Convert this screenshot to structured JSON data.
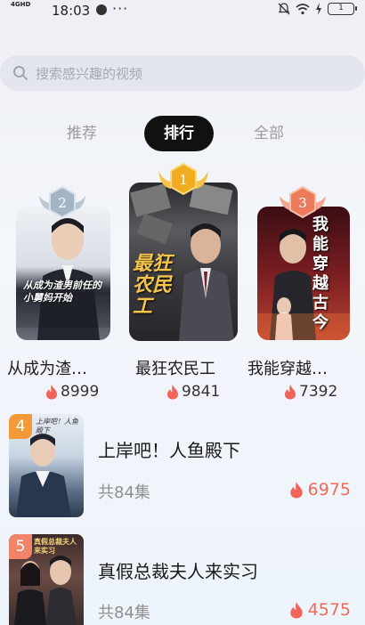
{
  "status_bar": {
    "network": "4GHD",
    "time": "18:03",
    "more": "···",
    "battery": "1"
  },
  "search": {
    "placeholder": "搜索感兴趣的视频"
  },
  "tabs": [
    {
      "label": "推荐",
      "active": false
    },
    {
      "label": "排行",
      "active": true
    },
    {
      "label": "全部",
      "active": false
    }
  ],
  "podium": [
    {
      "rank": "2",
      "title": "从成为渣…",
      "heat": "8999",
      "poster_text": "从成为渣男前任的小舅妈开始",
      "medal_color": "#a9b9c9"
    },
    {
      "rank": "1",
      "title": "最狂农民工",
      "heat": "9841",
      "poster_text": "最狂农民工",
      "medal_color": "#f3b63a"
    },
    {
      "rank": "3",
      "title": "我能穿越…",
      "heat": "7392",
      "poster_text": "我能穿越古今",
      "medal_color": "#f0846a"
    }
  ],
  "list": [
    {
      "rank": "4",
      "title": "上岸吧！人鱼殿下",
      "episodes": "共84集",
      "heat": "6975",
      "thumb_text": "上岸吧！人鱼殿下",
      "badge_color": "#f29a38"
    },
    {
      "rank": "5",
      "title": "真假总裁夫人来实习",
      "episodes": "共84集",
      "heat": "4575",
      "thumb_text": "真假总裁夫人来实习",
      "badge_color": "#f0846a"
    }
  ],
  "colors": {
    "accent_heat": "#f06a5a",
    "tab_active_bg": "#111111"
  }
}
